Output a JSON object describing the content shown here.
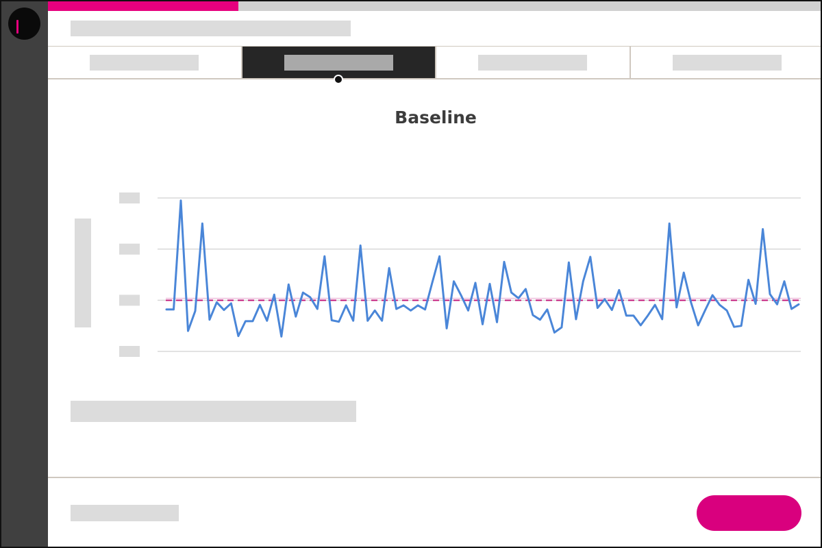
{
  "progress": {
    "fraction": 0.246
  },
  "tabs": [
    {
      "id": "tab-1",
      "active": false
    },
    {
      "id": "tab-2",
      "active": true
    },
    {
      "id": "tab-3",
      "active": false
    },
    {
      "id": "tab-4",
      "active": false
    }
  ],
  "chart_data": {
    "type": "line",
    "title": "Baseline",
    "xlabel": "",
    "ylabel": "",
    "ylim": [
      0,
      3
    ],
    "grid": true,
    "reference_line": {
      "value": 1.0,
      "color": "#c2187a",
      "style": "dashed"
    },
    "series": [
      {
        "color": "#4a86d8",
        "values": [
          0.82,
          0.82,
          2.95,
          0.4,
          0.79,
          2.5,
          0.62,
          0.96,
          0.81,
          0.94,
          0.3,
          0.59,
          0.59,
          0.91,
          0.6,
          1.11,
          0.29,
          1.31,
          0.68,
          1.15,
          1.06,
          0.83,
          1.86,
          0.61,
          0.58,
          0.9,
          0.6,
          2.07,
          0.6,
          0.8,
          0.6,
          1.63,
          0.83,
          0.9,
          0.8,
          0.9,
          0.82,
          1.35,
          1.86,
          0.45,
          1.37,
          1.1,
          0.8,
          1.34,
          0.53,
          1.32,
          0.57,
          1.75,
          1.15,
          1.04,
          1.22,
          0.71,
          0.62,
          0.82,
          0.37,
          0.47,
          1.74,
          0.63,
          1.37,
          1.85,
          0.85,
          1.02,
          0.81,
          1.2,
          0.7,
          0.7,
          0.51,
          0.7,
          0.91,
          0.63,
          2.5,
          0.86,
          1.54,
          0.96,
          0.51,
          0.81,
          1.1,
          0.91,
          0.8,
          0.48,
          0.5,
          1.4,
          0.93,
          2.39,
          1.12,
          0.92,
          1.37,
          0.83,
          0.92
        ]
      }
    ]
  },
  "cta": {
    "color": "#d9007e"
  },
  "brand": {
    "accent": "#e6007e"
  }
}
